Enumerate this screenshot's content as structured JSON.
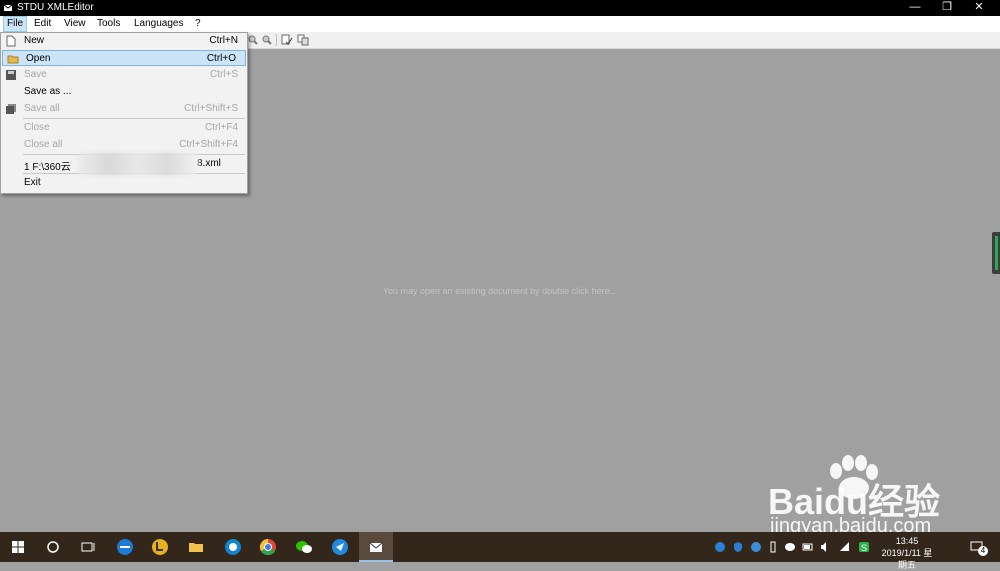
{
  "window": {
    "title": "STDU XMLEditor",
    "minimize": "—",
    "restore": "❐",
    "close": "✕"
  },
  "menubar": [
    {
      "label": "File"
    },
    {
      "label": "Edit"
    },
    {
      "label": "View"
    },
    {
      "label": "Tools"
    },
    {
      "label": "Languages"
    },
    {
      "label": "?"
    }
  ],
  "file_menu": {
    "new": {
      "label": "New",
      "accel": "Ctrl+N"
    },
    "open": {
      "label": "Open",
      "accel": "Ctrl+O"
    },
    "save": {
      "label": "Save",
      "accel": "Ctrl+S"
    },
    "save_as": {
      "label": "Save as ..."
    },
    "save_all": {
      "label": "Save all",
      "accel": "Ctrl+Shift+S"
    },
    "close": {
      "label": "Close",
      "accel": "Ctrl+F4"
    },
    "close_all": {
      "label": "Close all",
      "accel": "Ctrl+Shift+F4"
    },
    "recent_1": {
      "prefix": "1 F:\\360云",
      "suffix": "8.xml"
    },
    "exit": {
      "label": "Exit"
    }
  },
  "workspace": {
    "hint": "You may open an existing document by double click here..."
  },
  "taskbar": {
    "apps": [
      "start-icon",
      "cortana-icon",
      "task-view-icon",
      "edge-icon",
      "app-yellow-icon",
      "file-explorer-icon",
      "app-blue-icon",
      "chrome-icon",
      "wechat-icon",
      "feishu-icon",
      "xmleditor-icon"
    ],
    "time": "13:45",
    "date": "2019/1/11 星期五",
    "notif_count": "4"
  },
  "watermark": {
    "brand": "Baidu经验",
    "url": "jingyan.baidu.com"
  },
  "colors": {
    "titlebar": "#000000",
    "menu_highlight": "#cce4f7",
    "workspace": "#a0a0a0",
    "taskbar": "#33261a"
  }
}
